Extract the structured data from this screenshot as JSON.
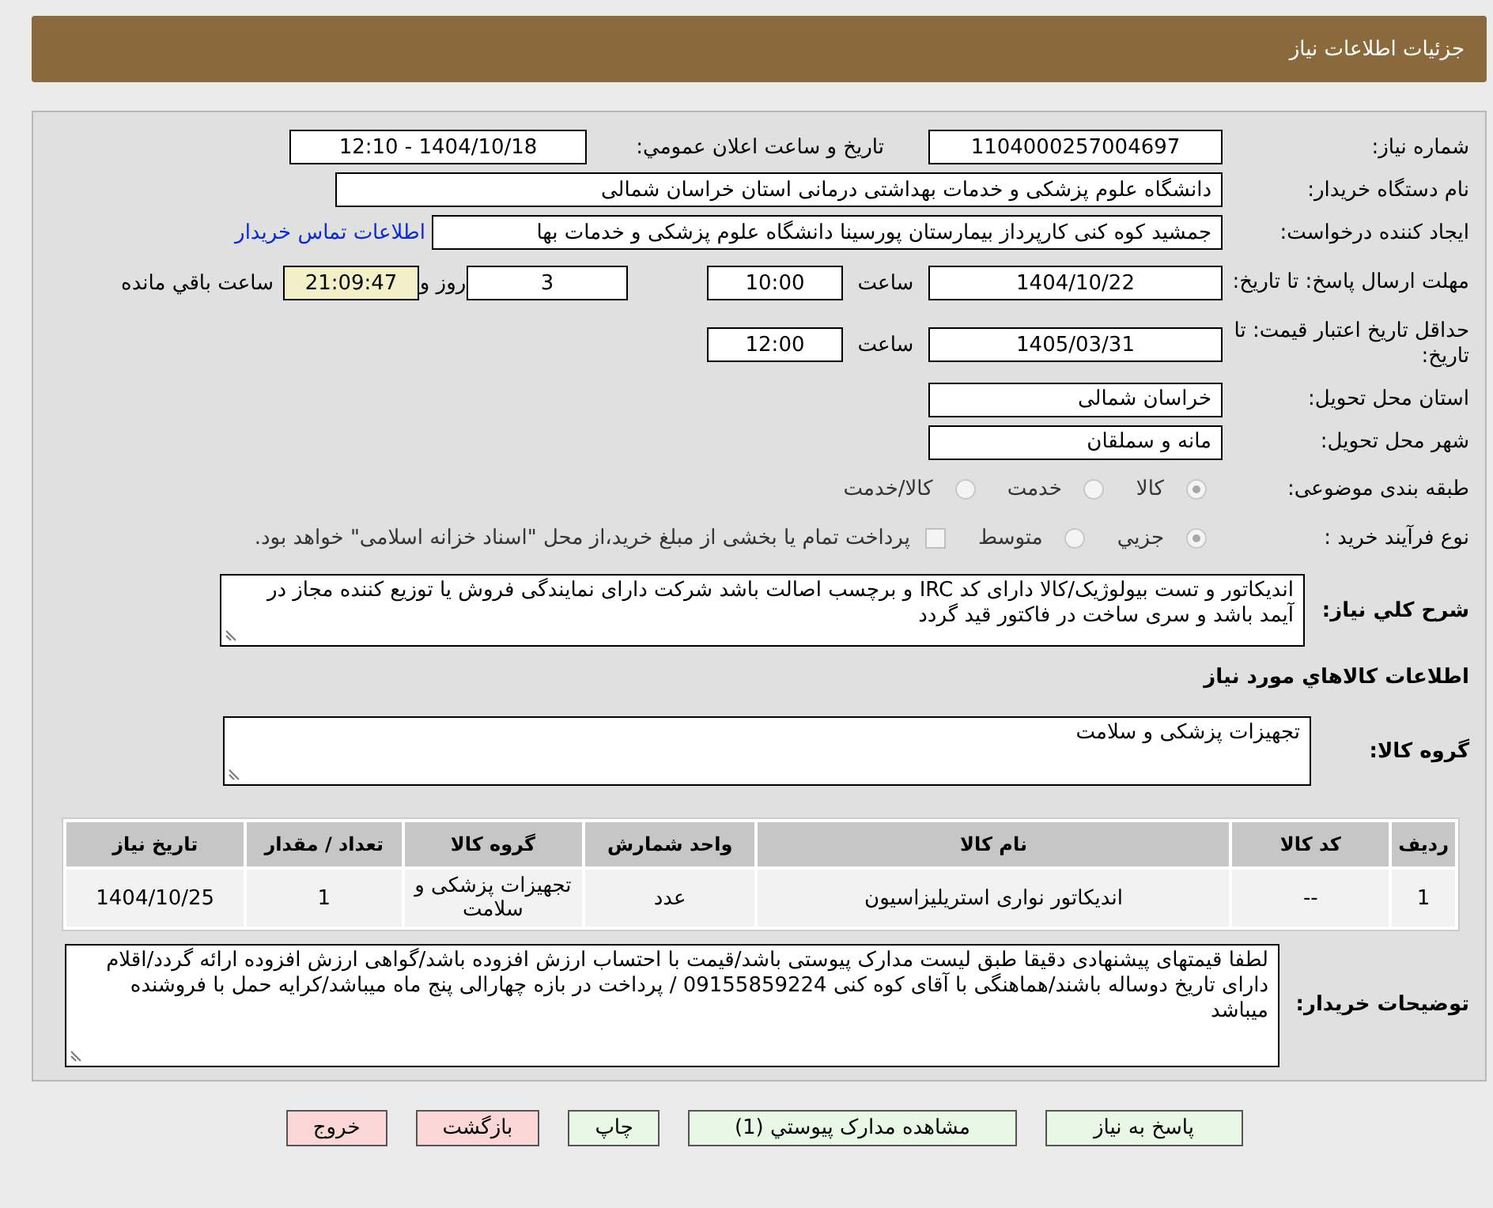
{
  "header": {
    "title": "جزئیات اطلاعات نیاز"
  },
  "need_number": {
    "label": "شماره نیاز:",
    "value": "1104000257004697"
  },
  "announce": {
    "label": "تاریخ و ساعت اعلان عمومي:",
    "value": "1404/10/18 - 12:10"
  },
  "buyer_org": {
    "label": "نام دستگاه خریدار:",
    "value": "دانشگاه علوم پزشکی و خدمات بهداشتی درمانی استان خراسان شمالی"
  },
  "requester": {
    "label": "ایجاد کننده درخواست:",
    "value": "جمشید کوه کنی کارپرداز بیمارستان پورسینا دانشگاه علوم پزشکی و خدمات بها",
    "link": "اطلاعات تماس خریدار"
  },
  "deadline": {
    "label": "مهلت ارسال پاسخ: تا تاریخ:",
    "date": "1404/10/22",
    "time_label": "ساعت",
    "time": "10:00",
    "days": "3",
    "days_label": "روز و",
    "remaining": "21:09:47",
    "remaining_label": "ساعت باقي مانده"
  },
  "validity": {
    "label": "حداقل تاریخ اعتبار قیمت: تا تاریخ:",
    "date": "1405/03/31",
    "time_label": "ساعت",
    "time": "12:00"
  },
  "province": {
    "label": "استان محل تحویل:",
    "value": "خراسان شمالی"
  },
  "city": {
    "label": "شهر محل تحویل:",
    "value": "مانه و سملقان"
  },
  "classification": {
    "label": "طبقه بندی موضوعی:",
    "options": [
      {
        "label": "کالا",
        "selected": true
      },
      {
        "label": "خدمت",
        "selected": false
      },
      {
        "label": "کالا/خدمت",
        "selected": false
      }
    ]
  },
  "process": {
    "label": "نوع فرآیند خرید :",
    "options": [
      {
        "label": "جزيي",
        "selected": true
      },
      {
        "label": "متوسط",
        "selected": false
      }
    ],
    "treasury": {
      "checked": false,
      "label": "پرداخت تمام یا بخشی از مبلغ خرید،از محل \"اسناد خزانه اسلامی\" خواهد بود."
    }
  },
  "description": {
    "label": "شرح کلي نیاز:",
    "value": "اندیکاتور و تست بیولوژیک/کالا دارای کد IRC و برچسب اصالت باشد شرکت دارای نمایندگی فروش یا توزیع کننده  مجاز در آیمد باشد و سری ساخت در فاکتور قید گردد"
  },
  "items_heading": "اطلاعات کالاهاي مورد نیاز",
  "goods_group": {
    "label": "گروه کالا:",
    "value": "تجهیزات پزشکی و سلامت"
  },
  "items_table": {
    "columns": [
      "ردیف",
      "کد کالا",
      "نام کالا",
      "واحد شمارش",
      "گروه کالا",
      "تعداد / مقدار",
      "تاریخ نیاز"
    ],
    "rows": [
      [
        "1",
        "--",
        "اندیکاتور نواری استریلیزاسیون",
        "عدد",
        "تجهیزات پزشکی و سلامت",
        "1",
        "1404/10/25"
      ]
    ]
  },
  "buyer_notes": {
    "label": "توضیحات خریدار:",
    "value": "لطفا قیمتهای پیشنهادی دقیقا طبق لیست مدارک پیوستی باشد/قیمت با احتساب ارزش افزوده باشد/گواهی ارزش افزوده ارائه گردد/اقلام دارای تاریخ دوساله باشند/هماهنگی با آقای کوه کنی 09155859224 / پرداخت در بازه چهارالی پنج ماه میباشد/کرایه حمل با فروشنده میباشد"
  },
  "buttons": [
    {
      "label": "پاسخ به نیاز",
      "kind": "normal"
    },
    {
      "label": "مشاهده مدارک پیوستي (1)",
      "kind": "normal"
    },
    {
      "label": "چاپ",
      "kind": "normal"
    },
    {
      "label": "بازگشت",
      "kind": "danger"
    },
    {
      "label": "خروج",
      "kind": "danger"
    }
  ]
}
